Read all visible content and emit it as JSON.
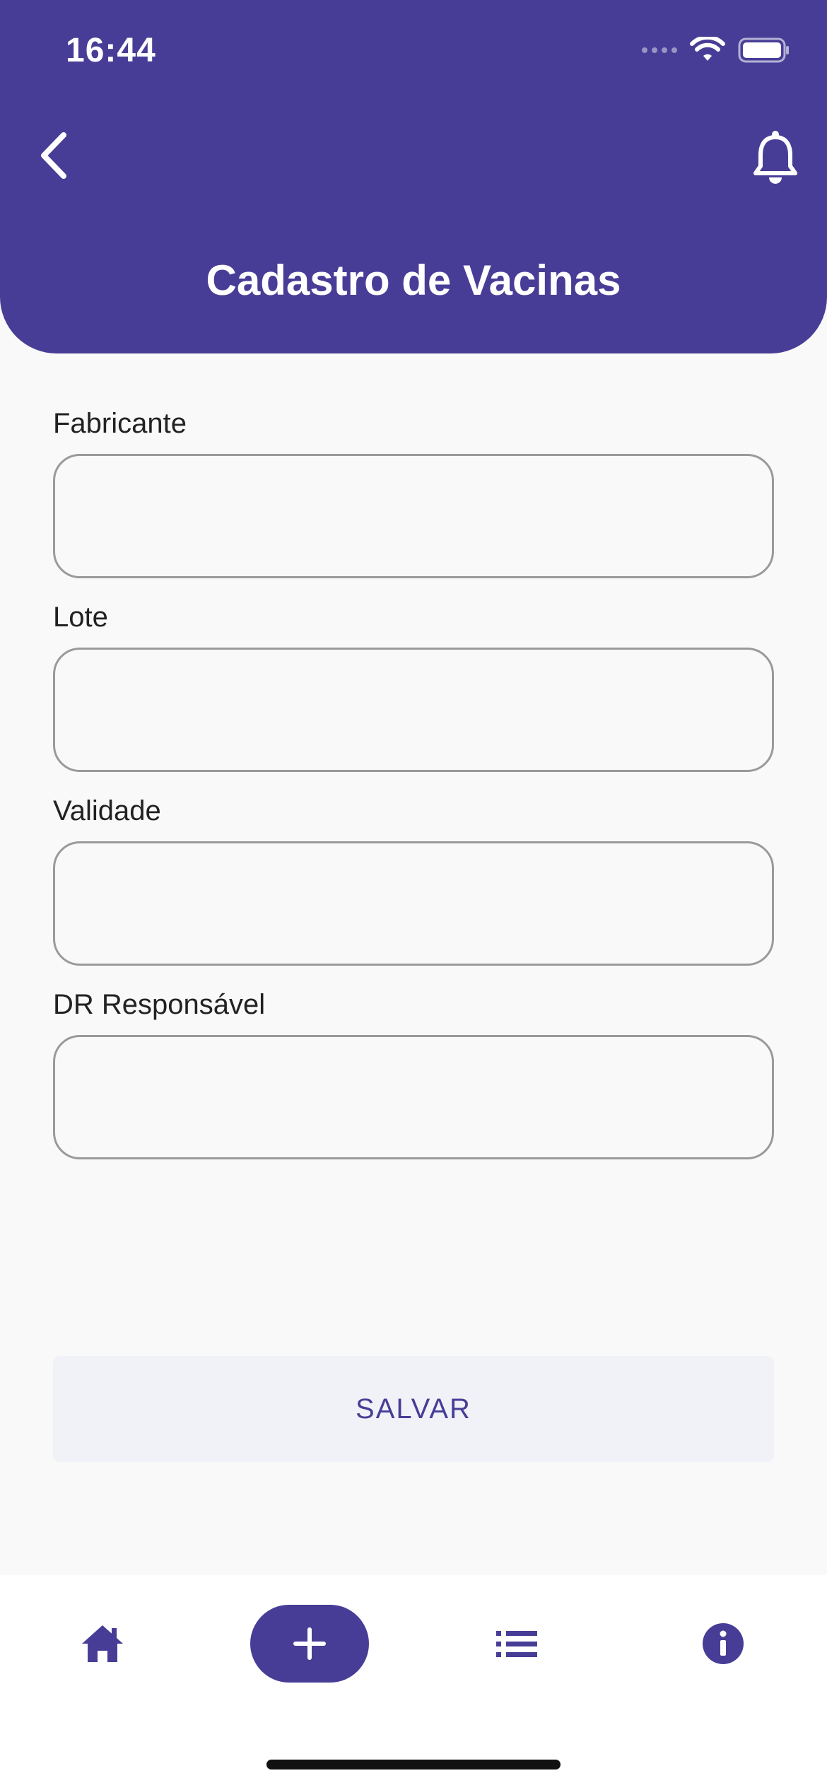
{
  "status_bar": {
    "time": "16:44"
  },
  "header": {
    "title": "Cadastro de Vacinas",
    "back_icon": "chevron-left-icon",
    "notification_icon": "bell-icon",
    "background_color": "#483d96"
  },
  "form": {
    "fields": [
      {
        "label": "Fabricante",
        "value": "",
        "placeholder": ""
      },
      {
        "label": "Lote",
        "value": "",
        "placeholder": ""
      },
      {
        "label": "Validade",
        "value": "",
        "placeholder": ""
      },
      {
        "label": "DR Responsável",
        "value": "",
        "placeholder": ""
      }
    ],
    "save_label": "SALVAR"
  },
  "bottom_nav": {
    "items": [
      {
        "icon": "home-icon",
        "active": false
      },
      {
        "icon": "plus-icon",
        "active": true
      },
      {
        "icon": "list-icon",
        "active": false
      },
      {
        "icon": "info-icon",
        "active": false
      }
    ]
  },
  "colors": {
    "accent": "#483d96",
    "background": "#f9f9f9",
    "button_bg": "#f1f2f8"
  }
}
